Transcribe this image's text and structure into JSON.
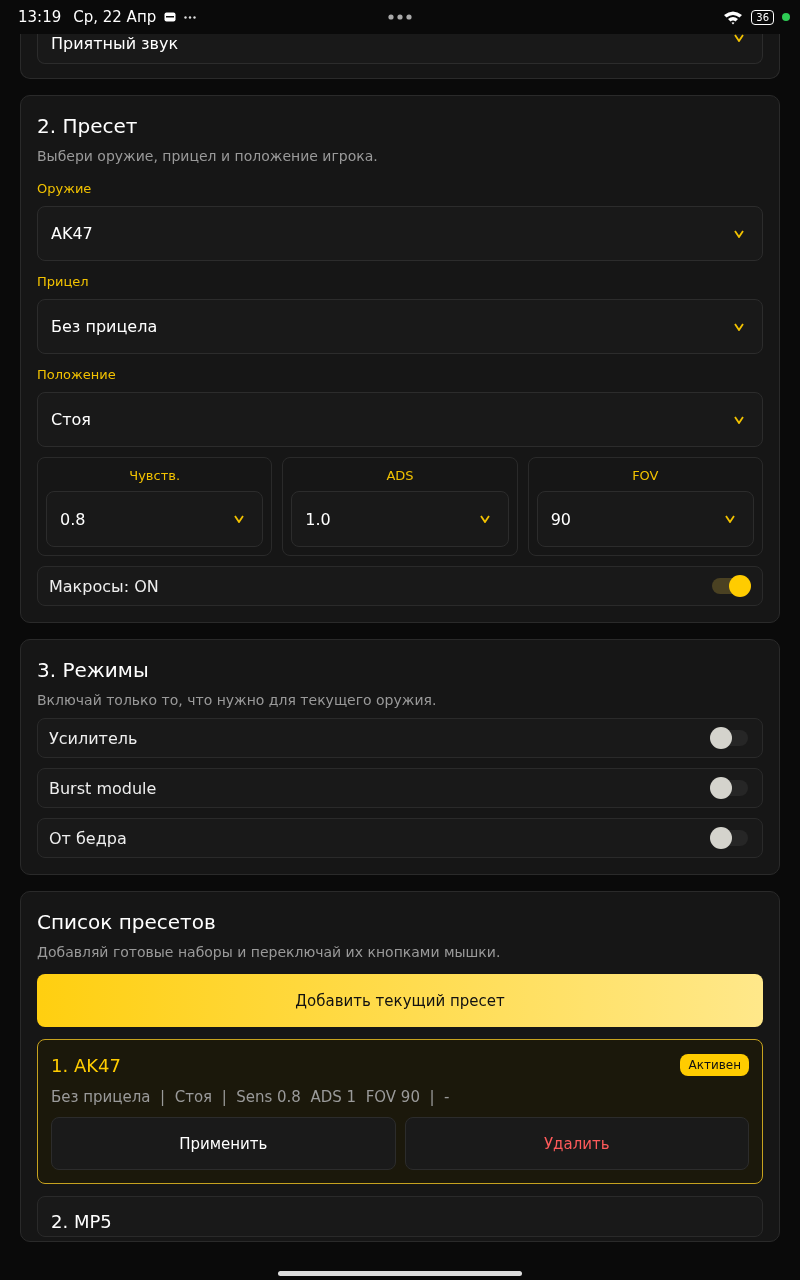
{
  "status_bar": {
    "time": "13:19",
    "date": "Ср, 22 Апр",
    "battery": "36"
  },
  "sound": {
    "value": "Приятный звук"
  },
  "preset": {
    "title": "2. Пресет",
    "subtitle": "Выбери оружие, прицел и положение игрока.",
    "fields": [
      {
        "label": "Оружие",
        "value": "AK47"
      },
      {
        "label": "Прицел",
        "value": "Без прицела"
      },
      {
        "label": "Положение",
        "value": "Стоя"
      }
    ],
    "params": [
      {
        "label": "Чувств.",
        "value": "0.8"
      },
      {
        "label": "ADS",
        "value": "1.0"
      },
      {
        "label": "FOV",
        "value": "90"
      }
    ],
    "macros": {
      "label": "Макросы: ON",
      "on": true
    }
  },
  "modes": {
    "title": "3. Режимы",
    "subtitle": "Включай только то, что нужно для текущего оружия.",
    "items": [
      {
        "label": "Усилитель",
        "on": false
      },
      {
        "label": "Burst module",
        "on": false
      },
      {
        "label": "От бедра",
        "on": false
      }
    ]
  },
  "presets": {
    "title": "Список пресетов",
    "subtitle": "Добавляй готовые наборы и переключай их кнопками мышки.",
    "add_button": "Добавить текущий пресет",
    "items": [
      {
        "title": "1. AK47",
        "active": true,
        "badge": "Активен",
        "details": "Без прицела  |  Стоя  |  Sens 0.8  ADS 1  FOV 90  |  -",
        "apply": "Применить",
        "delete": "Удалить"
      },
      {
        "title": "2. MP5",
        "active": false
      }
    ]
  }
}
